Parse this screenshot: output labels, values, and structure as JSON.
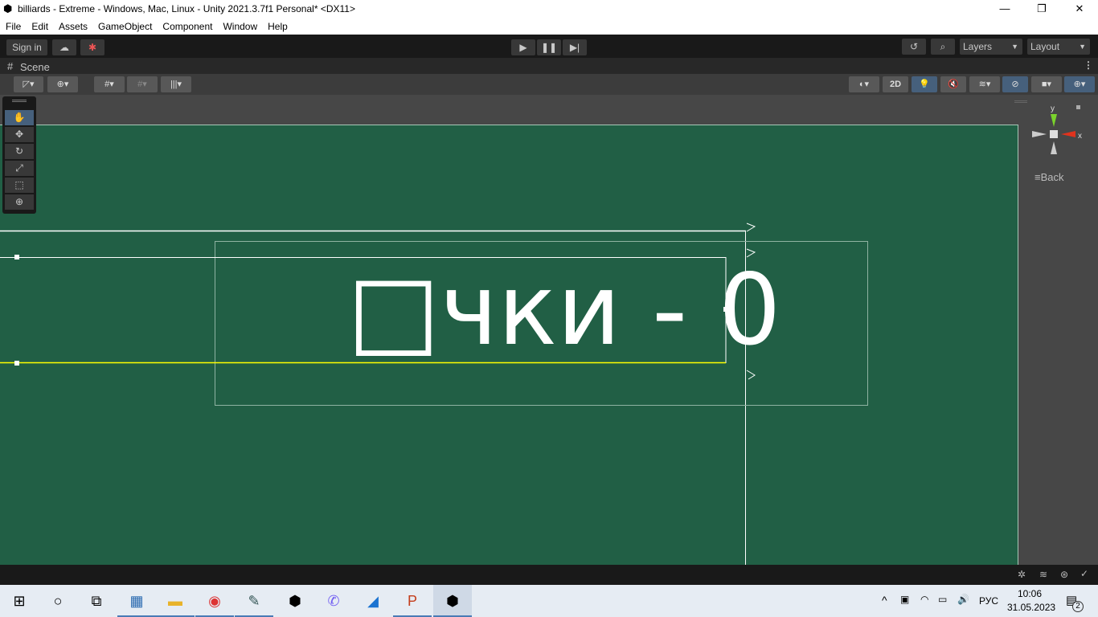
{
  "window": {
    "title": "billiards - Extreme - Windows, Mac, Linux - Unity 2021.3.7f1 Personal* <DX11>",
    "minimize": "—",
    "maximize": "❐",
    "close": "✕"
  },
  "menu": [
    "File",
    "Edit",
    "Assets",
    "GameObject",
    "Component",
    "Window",
    "Help"
  ],
  "toolbar": {
    "sign_in": "Sign in",
    "layers": "Layers",
    "layout": "Layout"
  },
  "scene_tab": {
    "label": "Scene"
  },
  "scene_toolbar": {
    "mode_2d": "2D"
  },
  "gizmo": {
    "y": "y",
    "x": "x",
    "back": "Back"
  },
  "scene": {
    "text": "□чки - 0"
  },
  "taskbar": {
    "lang": "РУС",
    "time": "10:06",
    "date": "31.05.2023",
    "notifications": "2"
  },
  "colors": {
    "scene_bg": "#215f45",
    "selection": "#ffff00",
    "accent": "#46607c"
  }
}
